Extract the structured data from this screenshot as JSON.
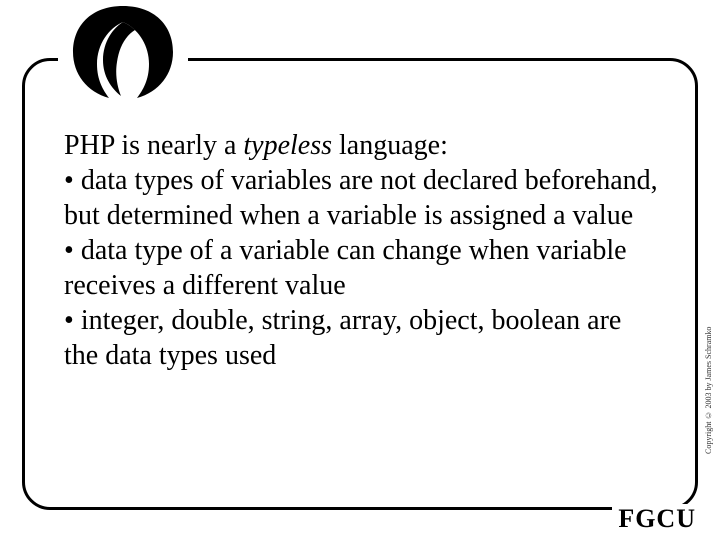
{
  "slide": {
    "lead_before": "PHP is nearly a ",
    "lead_em": "typeless",
    "lead_after": " language:",
    "bullets": [
      "data types of variables are not declared beforehand, but determined when a variable is assigned a value",
      "data type of a variable can change when variable receives a different value",
      "integer, double, string, array, object, boolean are the data types used"
    ]
  },
  "footer": {
    "org": "FGCU",
    "copyright": "Copyright © 2003 by James Schramko"
  }
}
